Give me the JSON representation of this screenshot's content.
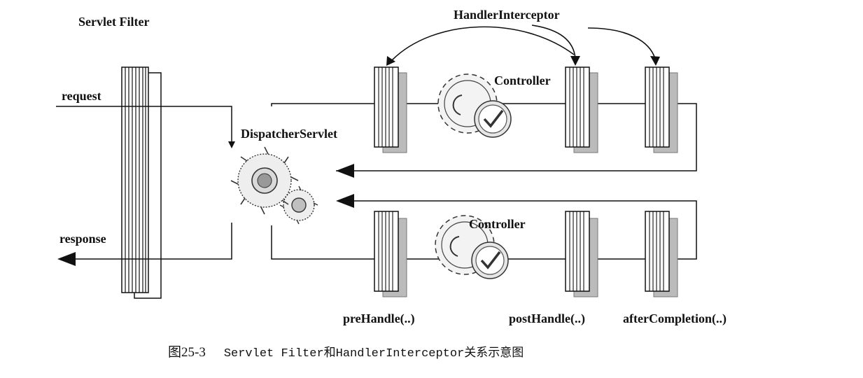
{
  "labels": {
    "servlet_filter": "Servlet Filter",
    "handler_interceptor": "HandlerInterceptor",
    "request": "request",
    "response": "response",
    "dispatcher_servlet": "DispatcherServlet",
    "controller_top": "Controller",
    "controller_bottom": "Controller",
    "pre_handle": "preHandle(..)",
    "post_handle": "postHandle(..)",
    "after_completion": "afterCompletion(..)"
  },
  "caption": {
    "figure_number": "图25-3",
    "text": "Servlet Filter和HandlerInterceptor关系示意图"
  },
  "colors": {
    "line": "#111111",
    "gear_stroke": "#333333",
    "gear_fill": "#e6e6e6",
    "shadow": "#9a9a9a"
  }
}
